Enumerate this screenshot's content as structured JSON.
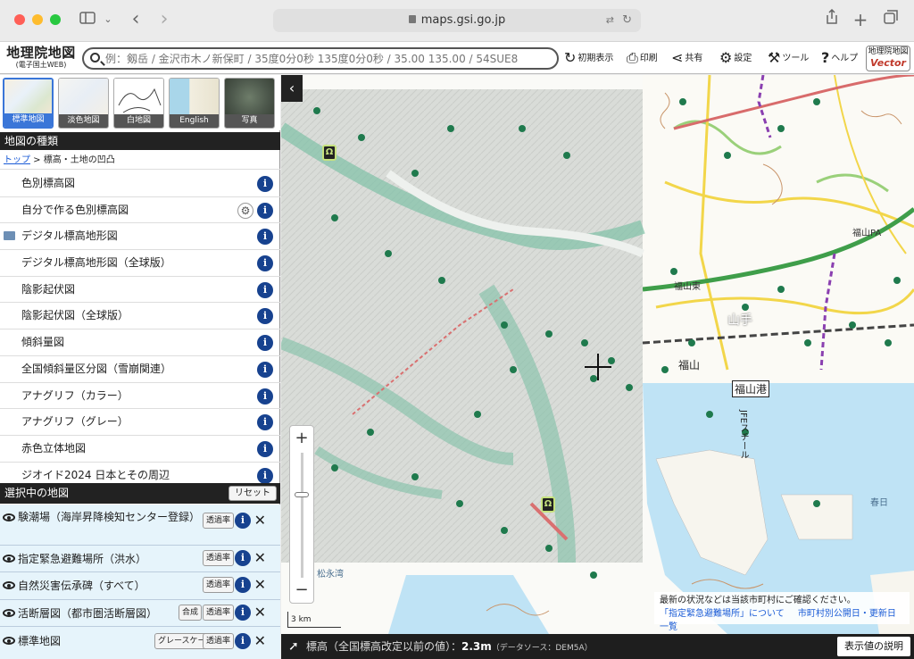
{
  "browser": {
    "url": "maps.gsi.go.jp"
  },
  "header": {
    "logo_title": "地理院地図",
    "logo_sub": "(電子国土WEB)",
    "search_placeholder": "例：剱岳 / 金沢市木ノ新保町 / 35度0分0秒 135度0分0秒 / 35.00 135.00 / 54SUE8",
    "buttons": {
      "reset": "初期表示",
      "print": "印刷",
      "share": "共有",
      "settings": "設定",
      "tools": "ツール",
      "help": "ヘルプ"
    },
    "vector_top": "地理院地図",
    "vector_bottom": "Vector"
  },
  "base_maps": [
    {
      "label": "標準地図"
    },
    {
      "label": "淡色地図"
    },
    {
      "label": "白地図"
    },
    {
      "label": "English"
    },
    {
      "label": "写真"
    }
  ],
  "map_types": {
    "title": "地図の種類",
    "breadcrumb_link": "トップ",
    "breadcrumb_rest": " > 標高・土地の凹凸",
    "items": [
      {
        "label": "色別標高図"
      },
      {
        "label": "自分で作る色別標高図"
      },
      {
        "label": "デジタル標高地形図"
      },
      {
        "label": "デジタル標高地形図（全球版）"
      },
      {
        "label": "陰影起伏図"
      },
      {
        "label": "陰影起伏図（全球版）"
      },
      {
        "label": "傾斜量図"
      },
      {
        "label": "全国傾斜量区分図（雪崩関連）"
      },
      {
        "label": "アナグリフ（カラー）"
      },
      {
        "label": "アナグリフ（グレー）"
      },
      {
        "label": "赤色立体地図"
      },
      {
        "label": "ジオイド2024 日本とその周辺"
      }
    ]
  },
  "selected": {
    "title": "選択中の地図",
    "reset_label": "リセット",
    "layers": [
      {
        "label": "験潮場（海岸昇降検知センター登録）",
        "opacity": "透過率"
      },
      {
        "label": "指定緊急避難場所（洪水）",
        "opacity": "透過率"
      },
      {
        "label": "自然災害伝承碑（すべて）",
        "opacity": "透過率"
      },
      {
        "label": "活断層図（都市圏活断層図）",
        "extra": "合成",
        "opacity": "透過率"
      },
      {
        "label": "標準地図",
        "extra": "グレースケール",
        "opacity": "透過率"
      }
    ]
  },
  "map": {
    "scale": "3 km",
    "notice_line1": "最新の状況などは当該市町村にご確認ください。",
    "notice_link1": "「指定緊急避難場所」について",
    "notice_link2": "市町村別公開日・更新日一覧",
    "labels": {
      "fukuyama_port": "福山港",
      "station": "福山",
      "yamanote": "山手",
      "jfe": "JFEスチール",
      "matsunaga": "松永湾",
      "kasuga": "春日",
      "fukuyama_east": "福山東",
      "fukuyama_pa": "福山PA"
    }
  },
  "bottom_bar": {
    "label": "標高（全国標高改定以前の値）：",
    "value": "2.3m",
    "source": "（データソース：DEM5A）",
    "desc_button": "表示値の説明"
  }
}
